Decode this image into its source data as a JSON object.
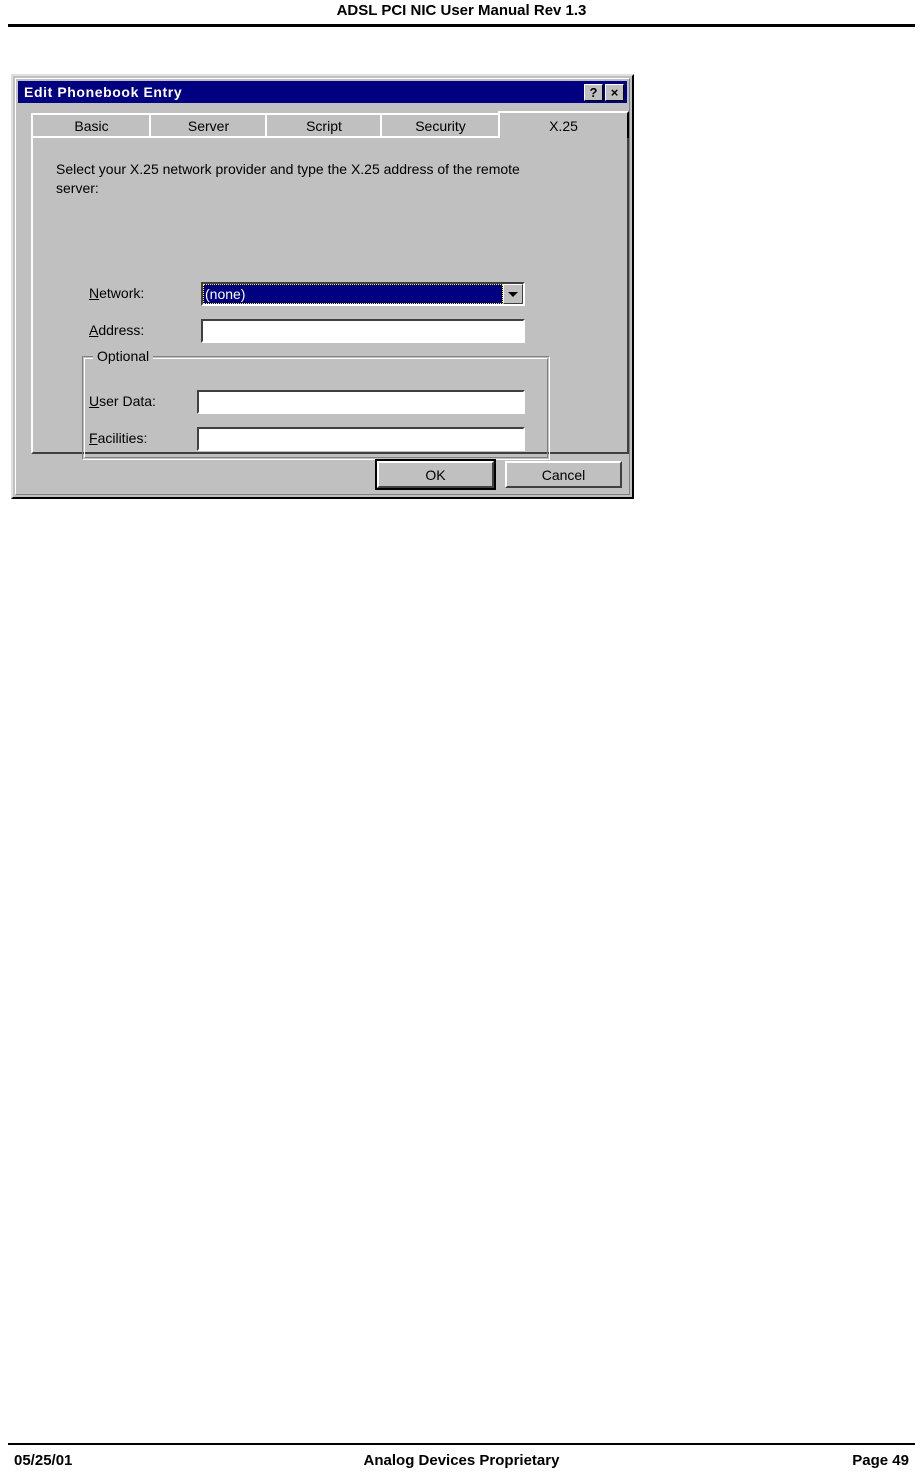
{
  "page": {
    "header_title": "ADSL PCI NIC User Manual Rev 1.3",
    "footer_date": "05/25/01",
    "footer_center": "Analog Devices Proprietary",
    "footer_page": "Page 49"
  },
  "dialog": {
    "title": "Edit Phonebook Entry",
    "help_button": "?",
    "close_button": "×",
    "tabs": [
      {
        "label": "Basic",
        "active": false
      },
      {
        "label": "Server",
        "active": false
      },
      {
        "label": "Script",
        "active": false
      },
      {
        "label": "Security",
        "active": false
      },
      {
        "label": "X.25",
        "active": true
      }
    ],
    "instruction": "Select your X.25 network provider and type the X.25 address of the remote server:",
    "fields": {
      "network": {
        "label_prefix": "N",
        "label_rest": "etwork:",
        "value": "(none)",
        "selected": true,
        "dropdown_icon": "chevron-down-icon"
      },
      "address": {
        "label_prefix": "A",
        "label_rest": "ddress:",
        "value": "",
        "placeholder": ""
      },
      "user_data": {
        "label_prefix": "U",
        "label_rest": "ser Data:",
        "value": "",
        "placeholder": ""
      },
      "facilities": {
        "label_prefix": "F",
        "label_rest": "acilities:",
        "value": "",
        "placeholder": ""
      }
    },
    "optional_group_label": "Optional",
    "buttons": {
      "ok": "OK",
      "cancel": "Cancel"
    },
    "colors": {
      "titlebar": "#000080",
      "face": "#c0c0c0",
      "selection": "#000080",
      "focus_outline": "#ffff00"
    }
  }
}
